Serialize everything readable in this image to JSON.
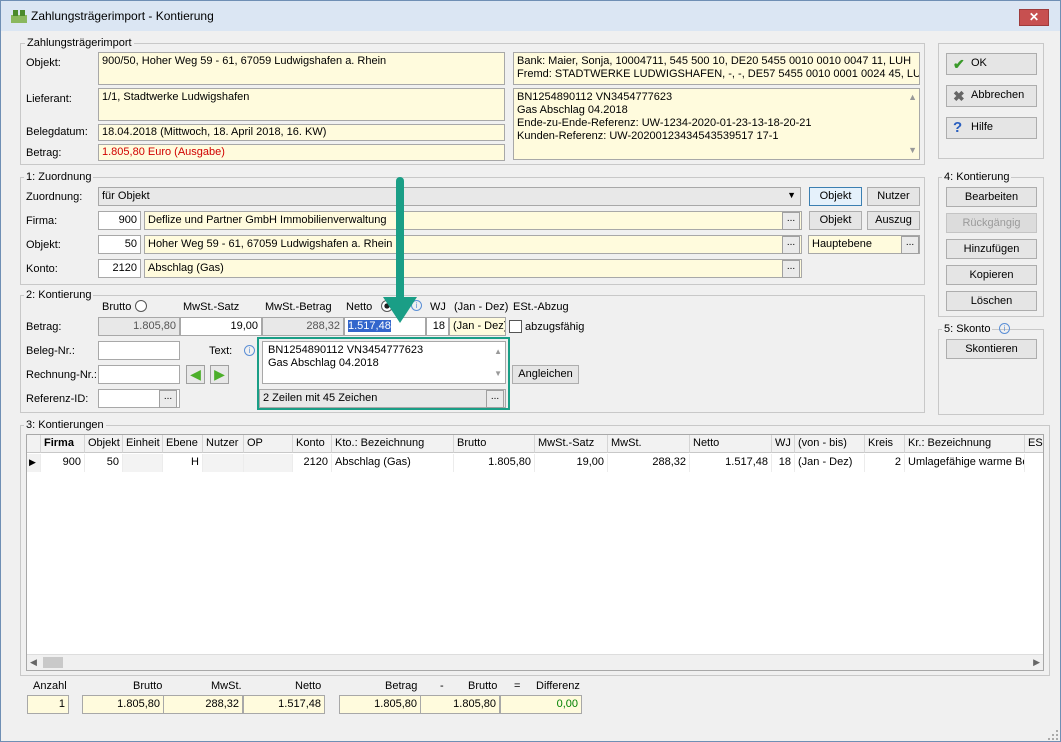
{
  "window": {
    "title": "Zahlungsträgerimport - Kontierung",
    "close": "✕"
  },
  "head": {
    "group": "Zahlungsträgerimport",
    "objekt_label": "Objekt:",
    "objekt_value": "900/50,  Hoher Weg 59 - 61, 67059 Ludwigshafen a. Rhein",
    "lieferant_label": "Lieferant:",
    "lieferant_value": "1/1,  Stadtwerke Ludwigshafen",
    "belegdatum_label": "Belegdatum:",
    "belegdatum_value": "18.04.2018  (Mittwoch,  18. April 2018,  16. KW)",
    "betrag_label": "Betrag:",
    "betrag_value": "1.805,80  Euro  (Ausgabe)",
    "bank_line1": "Bank: Maier, Sonja,  10004711,  545 500 10,  DE20 5455 0010 0010 0047 11,  LUH",
    "bank_line2": "Fremd: STADTWERKE LUDWIGSHAFEN,  -,  -,  DE57 5455 0010 0001 0024 45,  LUH",
    "vz_line1": "BN1254890112 VN3454777623",
    "vz_line2": "Gas Abschlag 04.2018",
    "vz_line3": "Ende-zu-Ende-Referenz: UW-1234-2020-01-23-13-18-20-21",
    "vz_line4": "Kunden-Referenz: UW-20200123434543539517 17-1"
  },
  "side": {
    "ok": "OK",
    "cancel": "Abbrechen",
    "help": "Hilfe",
    "kont_group": "4: Kontierung",
    "bearbeiten": "Bearbeiten",
    "rueck": "Rückgängig",
    "hinzu": "Hinzufügen",
    "kopieren": "Kopieren",
    "loeschen": "Löschen",
    "skonto_group": "5: Skonto",
    "skontieren": "Skontieren"
  },
  "zuordnung": {
    "group": "1: Zuordnung",
    "zuord_label": "Zuordnung:",
    "zuord_value": "für Objekt",
    "objekt_btn": "Objekt",
    "nutzer_btn": "Nutzer",
    "firma_label": "Firma:",
    "firma_nr": "900",
    "firma_name": "Deflize und Partner GmbH Immobilienverwaltung",
    "objekt_btn2": "Objekt",
    "auszug_btn": "Auszug",
    "objekt_label": "Objekt:",
    "objekt_nr": "50",
    "objekt_name": "Hoher Weg 59 - 61, 67059 Ludwigshafen a. Rhein",
    "ebene": "Hauptebene",
    "konto_label": "Konto:",
    "konto_nr": "2120",
    "konto_name": "Abschlag (Gas)"
  },
  "kontierung": {
    "group": "2: Kontierung",
    "brutto_h": "Brutto",
    "mwst_satz_h": "MwSt.-Satz",
    "mwst_betrag_h": "MwSt.-Betrag",
    "netto_h": "Netto",
    "wj_h": "WJ",
    "jan_dez_h": "(Jan - Dez)",
    "est_h": "ESt.-Abzug",
    "betrag_label": "Betrag:",
    "brutto": "1.805,80",
    "satz": "19,00",
    "mwst": "288,32",
    "netto": "1.517,48",
    "wj": "18",
    "jan_dez": "(Jan - Dez)",
    "abzug": "abzugsfähig",
    "beleg_label": "Beleg-Nr.:",
    "rechnung_label": "Rechnung-Nr.:",
    "referenz_label": "Referenz-ID:",
    "text_label": "Text:",
    "text_line1": "BN1254890112 VN3454777623",
    "text_line2": "Gas Abschlag 04.2018",
    "angleichen": "Angleichen",
    "zeilen": "2 Zeilen mit 45 Zeichen"
  },
  "list": {
    "group": "3: Kontierungen",
    "columns": [
      "Firma",
      "Objekt",
      "Einheit",
      "Ebene",
      "Nutzer",
      "OP",
      "Konto",
      "Kto.: Bezeichnung",
      "Brutto",
      "MwSt.-Satz",
      "MwSt.",
      "Netto",
      "WJ",
      "(von - bis)",
      "Kreis",
      "Kr.: Bezeichnung",
      "ES"
    ],
    "row": [
      "900",
      "50",
      "",
      "H",
      "",
      "",
      "2120",
      "Abschlag (Gas)",
      "1.805,80",
      "19,00",
      "288,32",
      "1.517,48",
      "18",
      "(Jan - Dez)",
      "2",
      "Umlagefähige warme Bet",
      ""
    ]
  },
  "totals": {
    "anzahl_h": "Anzahl",
    "brutto_h": "Brutto",
    "mwst_h": "MwSt.",
    "netto_h": "Netto",
    "betrag_h": "Betrag",
    "minus": "-",
    "brutto2_h": "Brutto",
    "eq": "=",
    "diff_h": "Differenz",
    "anzahl": "1",
    "brutto": "1.805,80",
    "mwst": "288,32",
    "netto": "1.517,48",
    "betrag": "1.805,80",
    "brutto2": "1.805,80",
    "diff": "0,00"
  },
  "colors": {
    "accent": "#1a9e86",
    "error": "#d00000",
    "diff": "#008000"
  }
}
